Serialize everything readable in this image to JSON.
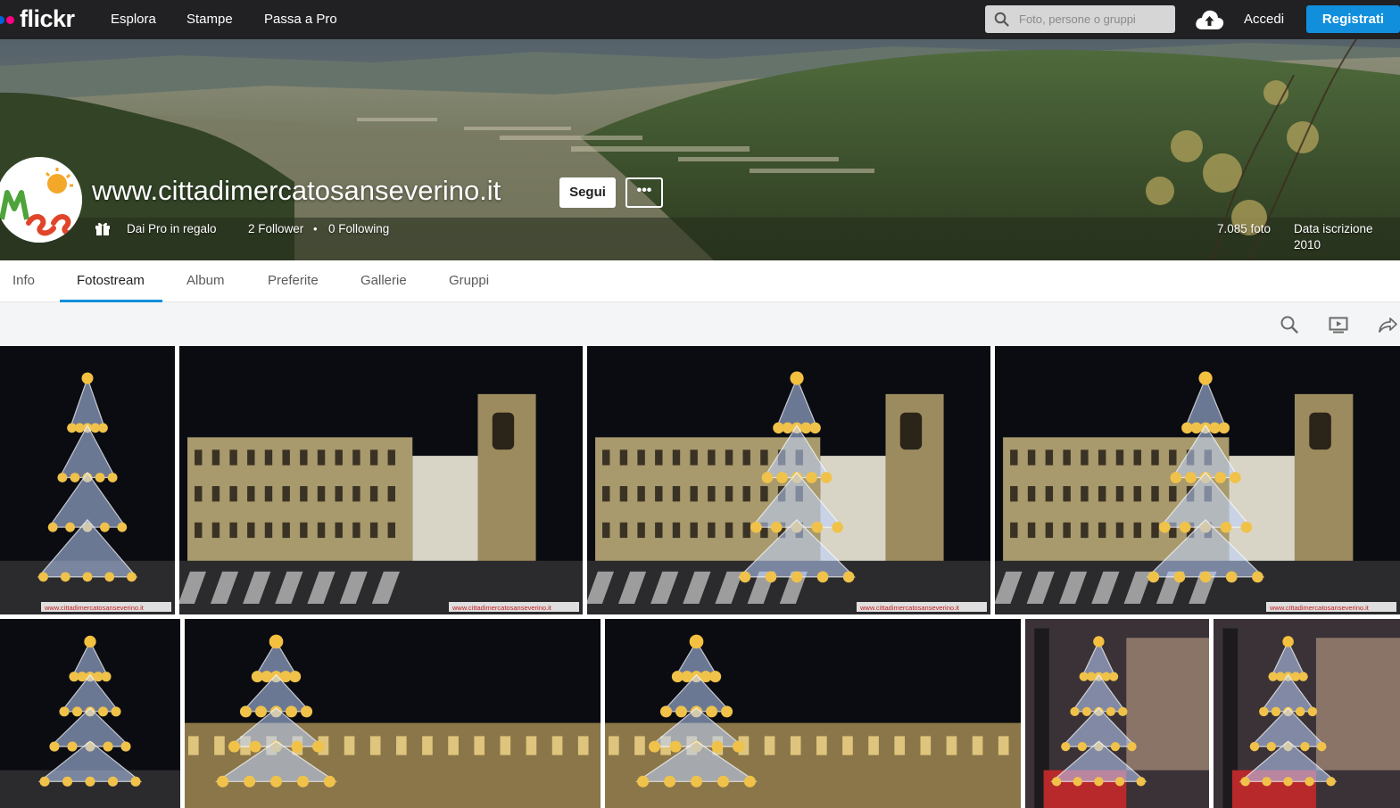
{
  "nav": {
    "logo": "flickr",
    "links": [
      "Esplora",
      "Stampe",
      "Passa a Pro"
    ],
    "search_placeholder": "Foto, persone o gruppi",
    "login": "Accedi",
    "signup": "Registrati"
  },
  "profile": {
    "name": "www.cittadimercatosanseverino.it",
    "follow_label": "Segui",
    "more_label": "•••",
    "pro_gift": "Dai Pro in regalo",
    "followers": "2 Follower",
    "following": "0 Following",
    "separator": "•",
    "photo_count": "7.085 foto",
    "joined": "Data iscrizione 2010",
    "avatar_text": "MSS"
  },
  "tabs": [
    "Info",
    "Fotostream",
    "Album",
    "Preferite",
    "Gallerie",
    "Gruppi"
  ],
  "active_tab": "Fotostream",
  "toolbar": [
    "search-icon",
    "slideshow-icon",
    "share-icon"
  ],
  "photos": [
    {
      "subject": "christmas-tree",
      "watermark": "www.cittadimercatosanseverino.it"
    },
    {
      "subject": "palace",
      "watermark": "www.cittadimercatosanseverino.it"
    },
    {
      "subject": "palace-tree",
      "watermark": "www.cittadimercatosanseverino.it"
    },
    {
      "subject": "palace-tree",
      "watermark": "www.cittadimercatosanseverino.it"
    },
    {
      "subject": "christmas-tree",
      "watermark": ""
    },
    {
      "subject": "tree-square",
      "watermark": ""
    },
    {
      "subject": "tree-square",
      "watermark": ""
    },
    {
      "subject": "street-tree",
      "watermark": ""
    },
    {
      "subject": "street-tree",
      "watermark": ""
    }
  ],
  "colors": {
    "topbar": "#212124",
    "signup": "#128fdc",
    "accent_underline": "#128fdc",
    "logo_blue": "#0063dc",
    "logo_pink": "#ff0084"
  }
}
